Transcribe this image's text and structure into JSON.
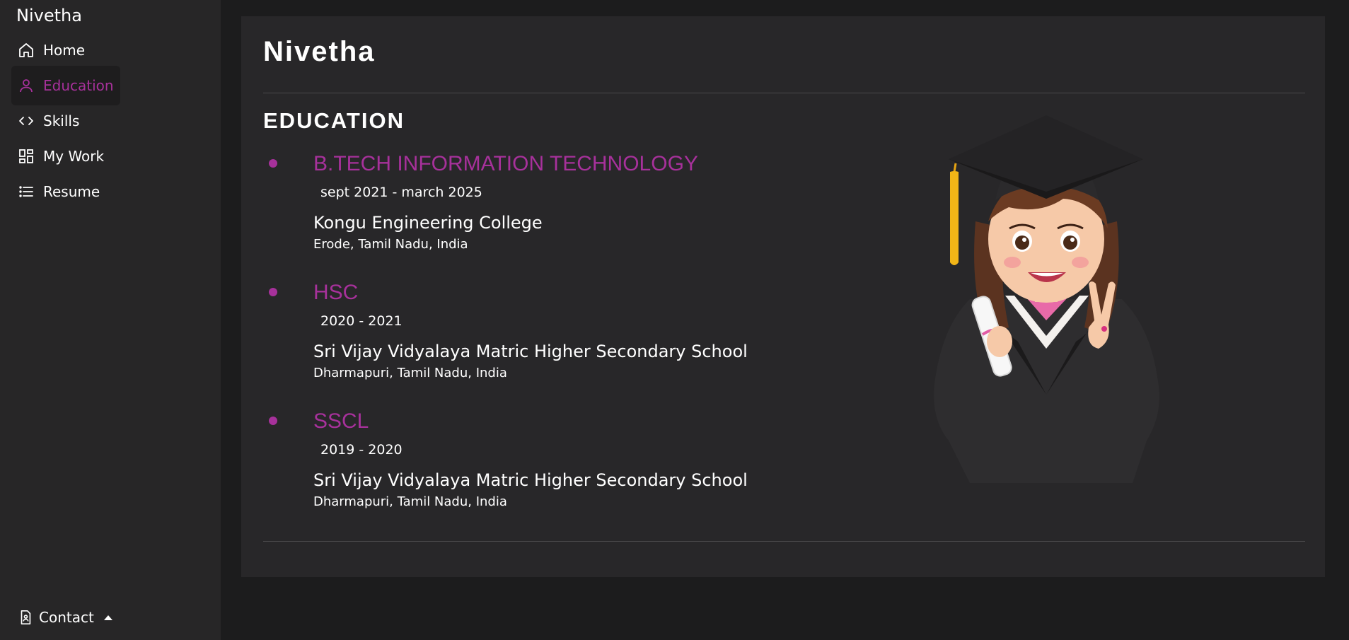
{
  "sidebar": {
    "brand": "Nivetha",
    "items": [
      {
        "label": "Home",
        "icon": "home-icon"
      },
      {
        "label": "Education",
        "icon": "person-icon",
        "active": true
      },
      {
        "label": "Skills",
        "icon": "code-icon"
      },
      {
        "label": "My Work",
        "icon": "dashboard-icon"
      },
      {
        "label": "Resume",
        "icon": "list-icon"
      }
    ],
    "contact": {
      "label": "Contact",
      "icon": "contact-card-icon"
    }
  },
  "main": {
    "title": "Nivetha",
    "section_heading": "EDUCATION",
    "education": [
      {
        "degree": "B.TECH INFORMATION TECHNOLOGY",
        "dates": "sept 2021 - march 2025",
        "school": "Kongu Engineering College",
        "location": "Erode, Tamil Nadu, India"
      },
      {
        "degree": "HSC",
        "dates": "2020 - 2021",
        "school": "Sri Vijay Vidyalaya Matric Higher Secondary School",
        "location": "Dharmapuri, Tamil Nadu, India"
      },
      {
        "degree": "SSCL",
        "dates": "2019 - 2020",
        "school": "Sri Vijay Vidyalaya Matric Higher Secondary School",
        "location": "Dharmapuri, Tamil Nadu, India"
      }
    ],
    "illustration": "graduate-girl-illustration"
  },
  "colors": {
    "accent": "#a7319b",
    "sidebar_bg": "#272627",
    "card_bg": "#282729",
    "page_bg": "#1c1c1d"
  }
}
